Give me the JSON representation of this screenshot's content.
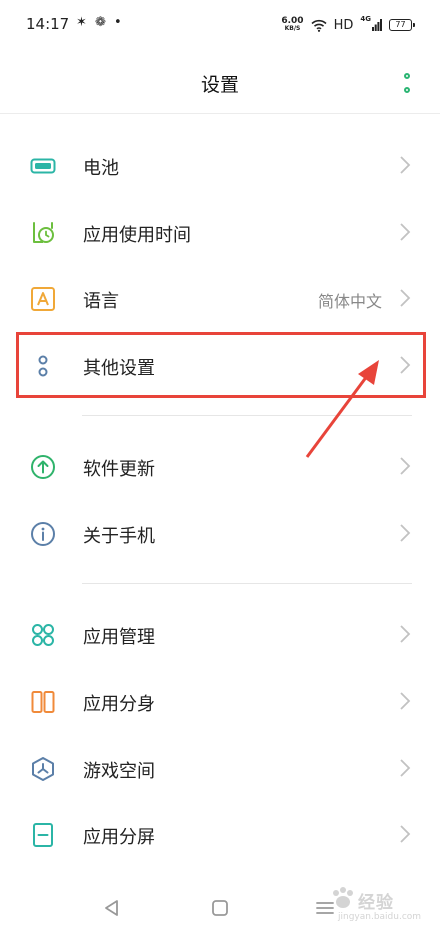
{
  "status_bar": {
    "time": "14:17",
    "notifications": "✶ ❁ •",
    "net_speed": "6.00",
    "net_unit": "KB/S",
    "hd": "HD",
    "signal_tag": "4G",
    "battery": "77"
  },
  "header": {
    "title": "设置"
  },
  "items": [
    {
      "label": "电池",
      "icon": "battery-icon",
      "color": "#2bb5a6"
    },
    {
      "label": "应用使用时间",
      "icon": "alarm-clock-icon",
      "color": "#6cbf3e"
    },
    {
      "label": "语言",
      "value": "简体中文",
      "icon": "letter-a-icon",
      "color": "#f0a838"
    },
    {
      "label": "其他设置",
      "icon": "two-dots-icon",
      "color": "#5b7fa8"
    },
    {
      "label": "软件更新",
      "icon": "upload-circle-icon",
      "color": "#2fb36b"
    },
    {
      "label": "关于手机",
      "icon": "info-circle-icon",
      "color": "#5b7fa8"
    },
    {
      "label": "应用管理",
      "icon": "grid-icon",
      "color": "#2bb5a6"
    },
    {
      "label": "应用分身",
      "icon": "twin-apps-icon",
      "color": "#f08a3a"
    },
    {
      "label": "游戏空间",
      "icon": "game-space-icon",
      "color": "#5b7fa8"
    },
    {
      "label": "应用分屏",
      "icon": "split-screen-icon",
      "color": "#2bb5a6"
    }
  ],
  "watermark": {
    "main": "经验",
    "sub": "jingyan.baidu.com"
  },
  "colors": {
    "accent": "#2bb573",
    "highlight": "#e8443a"
  }
}
